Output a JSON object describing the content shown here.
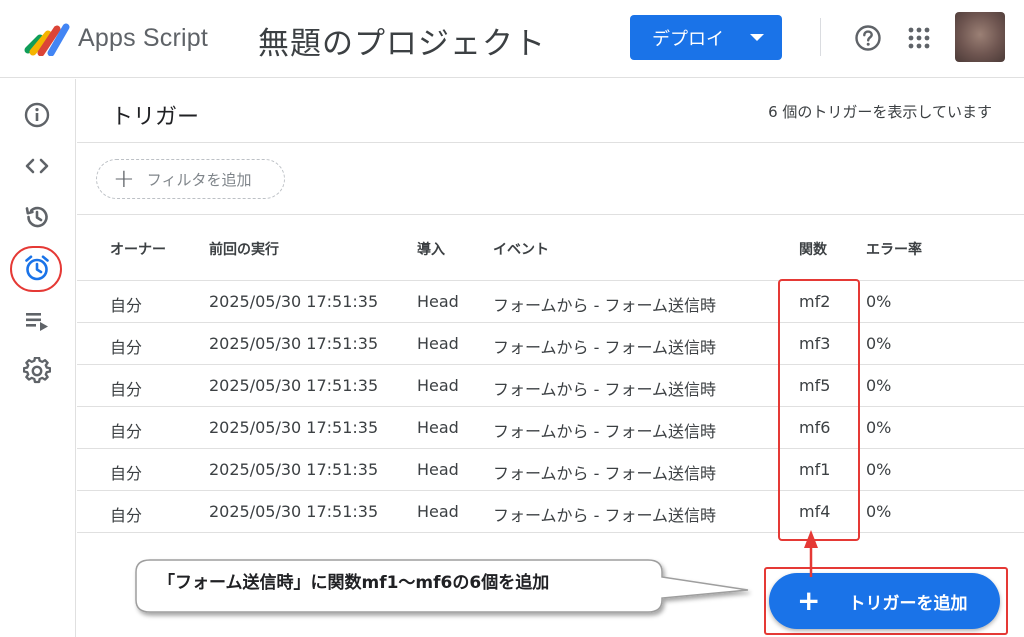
{
  "header": {
    "app_name": "Apps Script",
    "project_title": "無題のプロジェクト",
    "deploy_label": "デプロイ"
  },
  "sidebar": {
    "items": [
      {
        "name": "overview",
        "icon": "info-icon"
      },
      {
        "name": "editor",
        "icon": "code-icon"
      },
      {
        "name": "executions-history",
        "icon": "history-icon"
      },
      {
        "name": "triggers",
        "icon": "alarm-clock-icon",
        "active": true
      },
      {
        "name": "executions",
        "icon": "playlist-icon"
      },
      {
        "name": "settings",
        "icon": "gear-icon"
      }
    ]
  },
  "main": {
    "title": "トリガー",
    "count_text": "6 個のトリガーを表示しています",
    "filter_label": "フィルタを追加",
    "columns": [
      "オーナー",
      "前回の実行",
      "導入",
      "イベント",
      "関数",
      "エラー率"
    ],
    "rows": [
      {
        "owner": "自分",
        "last_run": "2025/05/30 17:51:35",
        "deployment": "Head",
        "event": "フォームから - フォーム送信時",
        "function": "mf2",
        "error_rate": "0%"
      },
      {
        "owner": "自分",
        "last_run": "2025/05/30 17:51:35",
        "deployment": "Head",
        "event": "フォームから - フォーム送信時",
        "function": "mf3",
        "error_rate": "0%"
      },
      {
        "owner": "自分",
        "last_run": "2025/05/30 17:51:35",
        "deployment": "Head",
        "event": "フォームから - フォーム送信時",
        "function": "mf5",
        "error_rate": "0%"
      },
      {
        "owner": "自分",
        "last_run": "2025/05/30 17:51:35",
        "deployment": "Head",
        "event": "フォームから - フォーム送信時",
        "function": "mf6",
        "error_rate": "0%"
      },
      {
        "owner": "自分",
        "last_run": "2025/05/30 17:51:35",
        "deployment": "Head",
        "event": "フォームから - フォーム送信時",
        "function": "mf1",
        "error_rate": "0%"
      },
      {
        "owner": "自分",
        "last_run": "2025/05/30 17:51:35",
        "deployment": "Head",
        "event": "フォームから - フォーム送信時",
        "function": "mf4",
        "error_rate": "0%"
      }
    ],
    "add_trigger_label": "トリガーを追加"
  },
  "annotation": {
    "callout_text": "「フォーム送信時」に関数mf1～mf6の6個を追加",
    "highlight_color": "#e53935"
  },
  "colors": {
    "primary": "#1a73e8",
    "text": "#3c4043",
    "divider": "#e0e0e0"
  }
}
